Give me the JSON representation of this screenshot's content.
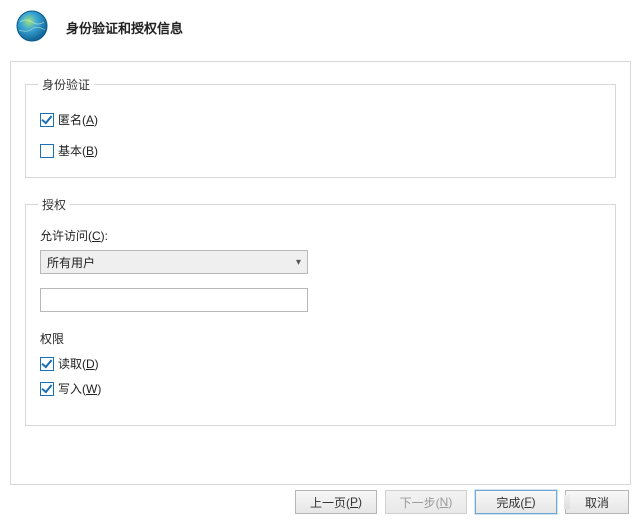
{
  "header": {
    "title": "身份验证和授权信息",
    "icon": "globe-icon"
  },
  "auth_group": {
    "legend": "身份验证",
    "anonymous": {
      "label": "匿名(",
      "accel": "A",
      "suffix": ")",
      "checked": true
    },
    "basic": {
      "label": "基本(",
      "accel": "B",
      "suffix": ")",
      "checked": false
    }
  },
  "authz_group": {
    "legend": "授权",
    "allow_label_pre": "允许访问(",
    "allow_label_accel": "C",
    "allow_label_suf": "):",
    "select_value": "所有用户",
    "text_value": "",
    "perm_label": "权限",
    "read": {
      "label": "读取(",
      "accel": "D",
      "suffix": ")",
      "checked": true
    },
    "write": {
      "label": "写入(",
      "accel": "W",
      "suffix": ")",
      "checked": true
    }
  },
  "buttons": {
    "prev": {
      "text": "上一页(",
      "accel": "P",
      "suffix": ")",
      "enabled": true
    },
    "next": {
      "text": "下一步(",
      "accel": "N",
      "suffix": ")",
      "enabled": false
    },
    "finish": {
      "text": "完成(",
      "accel": "F",
      "suffix": ")",
      "enabled": true
    },
    "cancel": {
      "text": "取消",
      "enabled": true
    }
  }
}
